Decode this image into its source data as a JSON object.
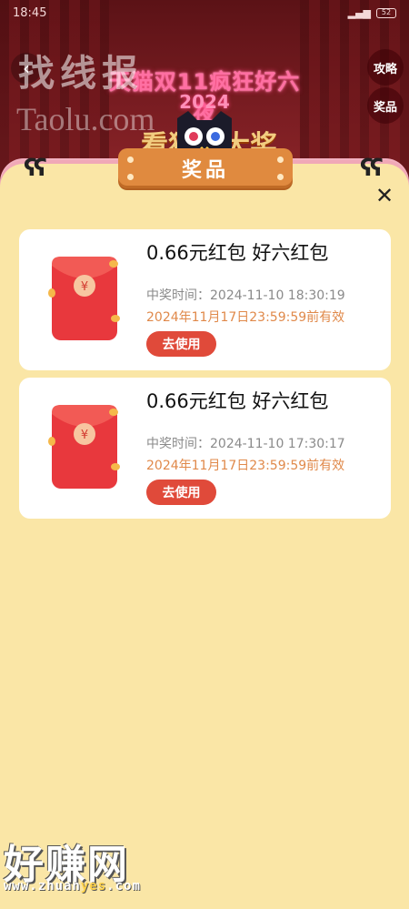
{
  "status_bar": {
    "time": "18:45",
    "signal": "📶",
    "battery": "52"
  },
  "banner": {
    "title": "天猫双11疯狂好六夜",
    "year": "2024",
    "subtitle": "看猫赢大奖"
  },
  "side_buttons": {
    "strategy": "攻略",
    "prize": "奖品"
  },
  "watermark_top": {
    "line1": "找线报",
    "line2": "Taolu.com"
  },
  "sheet": {
    "title": "奖品",
    "close": "✕"
  },
  "prizes": [
    {
      "name": "0.66元红包 好六红包",
      "time": "中奖时间：2024-11-10 18:30:19",
      "expire": "2024年11月17日23:59:59前有效",
      "button": "去使用"
    },
    {
      "name": "0.66元红包 好六红包",
      "time": "中奖时间：2024-11-10 17:30:17",
      "expire": "2024年11月17日23:59:59前有效",
      "button": "去使用"
    }
  ],
  "envelope_symbol": "¥",
  "watermark_bottom": {
    "brand": "好赚网",
    "url_pre": "www.zhuan",
    "url_hl": "yes",
    "url_post": ".com"
  },
  "colors": {
    "sheet_bg": "#fae6a6",
    "accent_orange": "#e08a3f",
    "button_red": "#e04a3a",
    "expire_text": "#e0894a"
  }
}
